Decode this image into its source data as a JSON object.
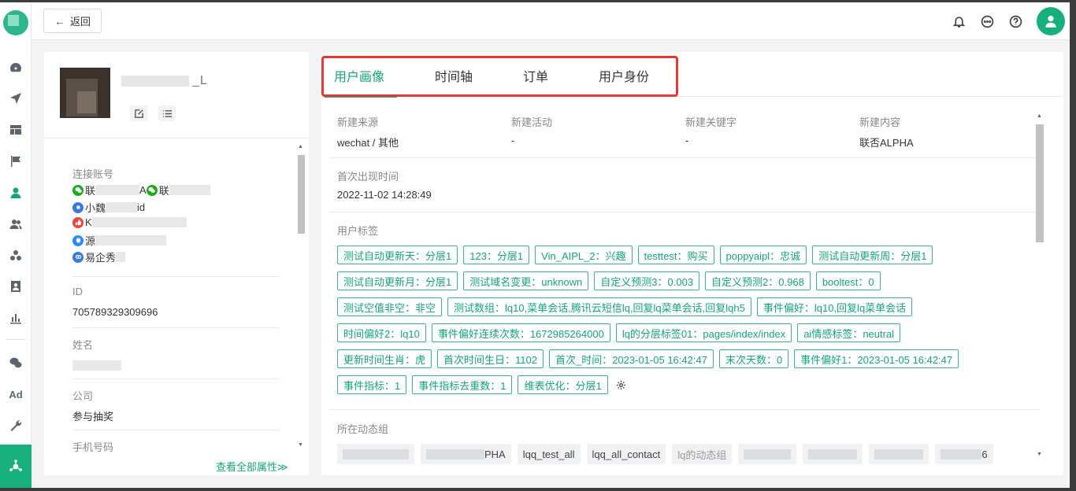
{
  "header": {
    "back_label": "返回",
    "icons": [
      "bell-icon",
      "chat-icon",
      "help-icon",
      "user-avatar-icon"
    ]
  },
  "sidebar": {
    "items": [
      "dashboard-icon",
      "send-icon",
      "layout-icon",
      "flag-icon",
      "user-icon",
      "users-icon",
      "segments-icon",
      "contact-card-icon",
      "chart-icon",
      "wechat-icon",
      "ad-icon",
      "tool-icon",
      "hub-icon"
    ],
    "ad_label": "Ad"
  },
  "profile": {
    "name_suffix": "_L",
    "connected_accounts_label": "连接账号",
    "accounts": [
      {
        "icon": "wechat-icon",
        "color": "#1aad19",
        "text_a": "联",
        "text_b": "A",
        "text_c": "联"
      },
      {
        "icon": "miniprogram-icon",
        "color": "#3a7bd5",
        "text_a": "小魏",
        "text_b": "id"
      },
      {
        "icon": "thumb-icon",
        "color": "#e8453c",
        "text_a": "K"
      },
      {
        "icon": "qq-icon",
        "color": "#2a8cff",
        "text_a": "源"
      },
      {
        "icon": "link-icon",
        "color": "#3a7bd5",
        "text_a": "易企秀"
      }
    ],
    "id_label": "ID",
    "id_value": "705789329309696",
    "name_label": "姓名",
    "company_label": "公司",
    "company_value": "参与抽奖",
    "phone_label": "手机号码",
    "see_all_label": "查看全部属性≫"
  },
  "tabs": [
    {
      "label": "用户画像",
      "active": true
    },
    {
      "label": "时间轴",
      "active": false
    },
    {
      "label": "订单",
      "active": false
    },
    {
      "label": "用户身份",
      "active": false
    }
  ],
  "overview": {
    "fields": [
      {
        "label": "新建来源",
        "value": "wechat / 其他"
      },
      {
        "label": "新建活动",
        "value": "-"
      },
      {
        "label": "新建关键字",
        "value": "-"
      },
      {
        "label": "新建内容",
        "value": "联否ALPHA"
      }
    ],
    "first_seen_label": "首次出现时间",
    "first_seen_value": "2022-11-02 14:28:49",
    "tags_label": "用户标签",
    "tags": [
      [
        "测试自动更新天：分层1",
        "123：分层1",
        "Vin_AIPL_2：兴趣",
        "testtest：购买",
        "poppyaipl：忠诚",
        "测试自动更新周：分层1"
      ],
      [
        "测试自动更新月：分层1",
        "测试域名变更：unknown",
        "自定义预测3：0.003",
        "自定义预测2：0.968",
        "booltest：0"
      ],
      [
        "测试空值非空：非空",
        "测试数组：lq10,菜单会话,腾讯云短信lq,回复lq菜单会话,回复lqh5",
        "事件偏好：lq10,回复lq菜单会话"
      ],
      [
        "时间偏好2：lq10",
        "事件偏好连续次数：1672985264000",
        "lq的分层标签01：pages/index/index",
        "ai情感标签：neutral"
      ],
      [
        "更新时间生肖：虎",
        "首次时间生日：1102",
        "首次_时间：2023-01-05 16:42:47",
        "末次天数：0",
        "事件偏好1：2023-01-05 16:42:47"
      ],
      [
        "事件指标：1",
        "事件指标去重数：1",
        "维表优化：分层1"
      ]
    ],
    "groups_label": "所在动态组",
    "groups": [
      "PHA",
      "lqq_test_all",
      "lqq_all_contact",
      "lq的动态组",
      "6"
    ]
  },
  "colors": {
    "accent": "#16a37a",
    "highlight": "#e53935"
  }
}
